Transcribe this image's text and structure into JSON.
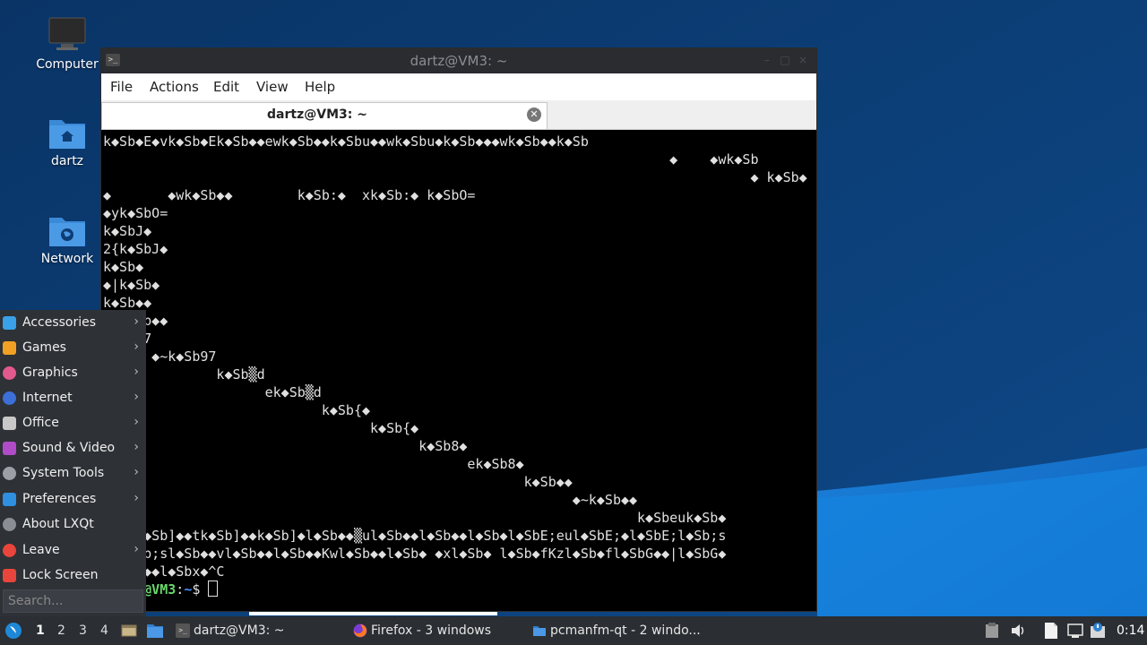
{
  "desktop": {
    "icons": [
      {
        "label": "Computer"
      },
      {
        "label": "dartz"
      },
      {
        "label": "Network"
      }
    ]
  },
  "window": {
    "title": "dartz@VM3: ~",
    "menu": [
      "File",
      "Actions",
      "Edit",
      "View",
      "Help"
    ],
    "tab": {
      "label": "dartz@VM3: ~"
    }
  },
  "terminal": {
    "lines": [
      "k◆Sb◆E◆vk◆Sb◆Ek◆Sb◆◆ewk◆Sb◆◆k◆Sbu◆◆wk◆Sbu◆k◆Sb◆◆◆wk◆Sb◆◆k◆Sb",
      "                                                                      ◆    ◆wk◆Sb",
      "                                                                                ◆ k◆Sb◆",
      "◆       ◆wk◆Sb◆◆        k◆Sb:◆  xk◆Sb:◆ k◆SbO=",
      "◆yk◆SbO=",
      "k◆SbJ◆",
      "2{k◆SbJ◆",
      "k◆Sb◆",
      "◆|k◆Sb◆",
      "k◆Sb◆◆",
      "     b◆◆",
      "     7",
      "      ◆~k◆Sb97",
      "              k◆Sb▒d",
      "                    ek◆Sb▒d",
      "                           k◆Sb{◆",
      "                                 k◆Sb{◆",
      "                                       k◆Sb8◆",
      "                                             ek◆Sb8◆",
      "                                                    k◆Sb◆◆",
      "                                                          ◆~k◆Sb◆◆",
      "                                                                  k◆Sbeuk◆Sb◆",
      "     ◆Sb]◆◆tk◆Sb]◆◆k◆Sb]◆l◆Sb◆◆▒ul◆Sb◆◆l◆Sb◆◆l◆Sb◆l◆SbE;eul◆SbE;◆l◆SbE;l◆Sb;s",
      "     b;sl◆Sb◆◆vl◆Sb◆◆l◆Sb◆◆Kwl◆Sb◆◆l◆Sb◆ ◆xl◆Sb◆ l◆Sb◆fKzl◆Sb◆fl◆SbG◆◆|l◆SbG◆",
      "     ◆◆l◆Sbx◆^C"
    ],
    "prompt_user": "@VM3",
    "prompt_sep": ":",
    "prompt_path": "~",
    "prompt_symbol": "$"
  },
  "app_menu": {
    "items": [
      {
        "label": "Accessories",
        "submenu": true,
        "color": "#3aa0e8"
      },
      {
        "label": "Games",
        "submenu": true,
        "color": "#f2a023"
      },
      {
        "label": "Graphics",
        "submenu": true,
        "color": "#e25a8c"
      },
      {
        "label": "Internet",
        "submenu": true,
        "color": "#3d6fd8"
      },
      {
        "label": "Office",
        "submenu": true,
        "color": "#c8c8c8"
      },
      {
        "label": "Sound & Video",
        "submenu": true,
        "color": "#b04cc8"
      },
      {
        "label": "System Tools",
        "submenu": true,
        "color": "#9aa0a6"
      },
      {
        "label": "Preferences",
        "submenu": true,
        "color": "#2f8fe0"
      },
      {
        "label": "About LXQt",
        "submenu": false,
        "color": "#8a8d93"
      },
      {
        "label": "Leave",
        "submenu": true,
        "color": "#e8453c"
      },
      {
        "label": "Lock Screen",
        "submenu": false,
        "color": "#e8453c"
      }
    ],
    "search_placeholder": "Search..."
  },
  "taskbar": {
    "desktops": [
      "1",
      "2",
      "3",
      "4"
    ],
    "tasks": [
      {
        "label": "dartz@VM3: ~",
        "icon": "terminal-icon"
      },
      {
        "label": "Firefox - 3 windows",
        "icon": "firefox-icon"
      },
      {
        "label": "pcmanfm-qt - 2 windo...",
        "icon": "folder-icon"
      }
    ],
    "clock": "0:14"
  }
}
